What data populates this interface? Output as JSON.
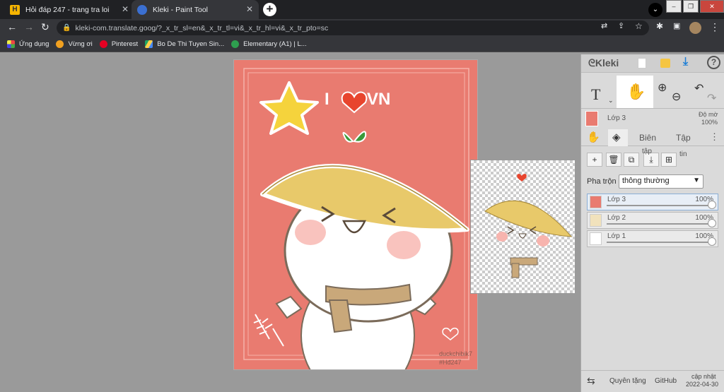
{
  "browser": {
    "tabs": [
      {
        "title": "Hỏi đáp 247 - trang tra loi",
        "active": false
      },
      {
        "title": "Kleki - Paint Tool",
        "active": true
      }
    ],
    "url": "kleki-com.translate.goog/?_x_tr_sl=en&_x_tr_tl=vi&_x_tr_hl=vi&_x_tr_pto=sc",
    "bookmarks": [
      "Ứng dụng",
      "Vừng ơi",
      "Pinterest",
      "Bo De Thi Tuyen Sin...",
      "Elementary (A1) | L..."
    ]
  },
  "artwork": {
    "headline_letter": "I",
    "headline_word": "VN",
    "signature": "duckchibik7",
    "watermark": "#Hđ247"
  },
  "panel": {
    "brand": "Kleki",
    "text_tool": "T",
    "current_layer": "Lớp 3",
    "opacity_label": "Độ mờ",
    "opacity_value": "100%",
    "tabs": [
      "Biên",
      "Tập"
    ],
    "layer_actions": {
      "merge_label": "tập",
      "info_label": "tin"
    },
    "blend_label": "Pha trộn",
    "blend_value": "thông thường",
    "layers": [
      {
        "name": "Lớp 3",
        "opacity": "100%",
        "selected": true
      },
      {
        "name": "Lớp 2",
        "opacity": "100%",
        "selected": false
      },
      {
        "name": "Lớp 1",
        "opacity": "100%",
        "selected": false
      }
    ],
    "footer": {
      "donate": "Quyên tặng",
      "github": "GitHub",
      "updated_label": "cập nhật",
      "updated_date": "2022-04-30"
    }
  },
  "colors": {
    "artwork_bg": "#e97b70",
    "hat": "#e8c96a",
    "star": "#f5d33c",
    "heart": "#e8452e",
    "accent_blue": "#1e7fd6"
  }
}
